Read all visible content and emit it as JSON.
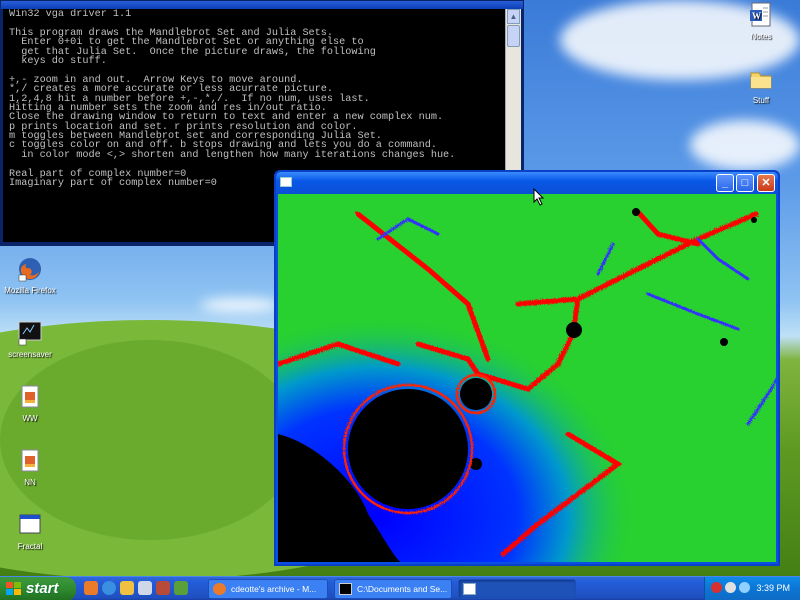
{
  "console": {
    "lines": [
      "Win32 vga driver 1.1",
      "",
      "This program draws the Mandlebrot Set and Julia Sets.",
      "  Enter 0+0i to get the Mandlebrot Set or anything else to",
      "  get that Julia Set.  Once the picture draws, the following",
      "  keys do stuff.",
      "",
      "+,- zoom in and out.  Arrow Keys to move around.",
      "*,/ creates a more accurate or less acurrate picture.",
      "1,2,4,8 hit a number before +,-,*,/.  If no num, uses last.",
      "Hitting a number sets the zoom and res in/out ratio.",
      "Close the drawing window to return to text and enter a new complex num.",
      "p prints location and set. r prints resolution and color.",
      "m toggles between Mandlebrot set and corresponding Julia Set.",
      "c toggles color on and off. b stops drawing and lets you do a command.",
      "  in color mode <,> shorten and lengthen how many iterations changes hue.",
      "",
      "Real part of complex number=0",
      "Imaginary part of complex number=0"
    ]
  },
  "desktop_icons": {
    "notes": "Notes",
    "stuff": "Stuff",
    "firefox": "Mozilla Firefox",
    "screensaver": "screensaver",
    "ww": "WW",
    "nn": "NN",
    "fractal": "Fractal"
  },
  "fractal_window": {
    "title": "",
    "minimize": "_",
    "maximize": "□",
    "close": "✕"
  },
  "taskbar": {
    "start_label": "start",
    "tasks": [
      {
        "label": "cdeotte's archive - M..."
      },
      {
        "label": "C:\\Documents and Se..."
      },
      {
        "label": ""
      }
    ],
    "clock": "3:39 PM"
  },
  "colors": {
    "taskbar_blue": "#245edb",
    "start_green": "#2f8a2f",
    "fractal_green": "#22cc22",
    "fractal_blue": "#0000ff",
    "fractal_red": "#ff0000"
  }
}
